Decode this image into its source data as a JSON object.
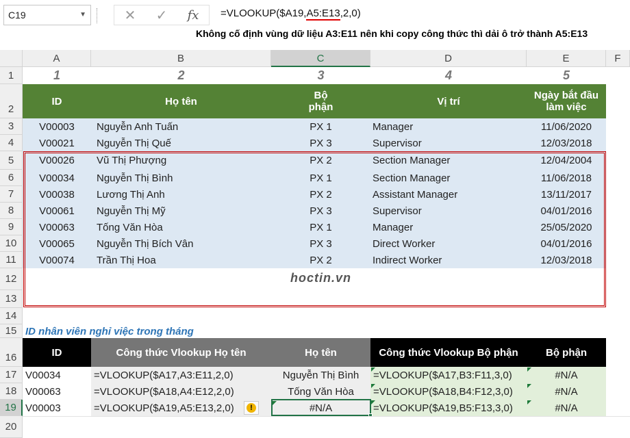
{
  "namebox": "C19",
  "formula": {
    "prefix": "=VLOOKUP($A19,",
    "range": "A5:E13",
    "suffix": ",2,0)"
  },
  "note": "Không cố định vùng dữ liệu A3:E11 nên khi copy công thức thì dải ô trở thành A5:E13",
  "columns": [
    "A",
    "B",
    "C",
    "D",
    "E",
    "F"
  ],
  "rows": [
    "1",
    "2",
    "3",
    "4",
    "5",
    "6",
    "7",
    "8",
    "9",
    "10",
    "11",
    "12",
    "13",
    "14",
    "15",
    "16",
    "17",
    "18",
    "19",
    "20"
  ],
  "row1": [
    "1",
    "2",
    "3",
    "4",
    "5"
  ],
  "header": {
    "id": "ID",
    "name": "Họ tên",
    "dept1": "Bộ",
    "dept2": "phận",
    "pos": "Vị trí",
    "date1": "Ngày bắt đầu",
    "date2": "làm việc"
  },
  "employees": [
    [
      "V00003",
      "Nguyễn Anh Tuấn",
      "PX 1",
      "Manager",
      "11/06/2020"
    ],
    [
      "V00021",
      "Nguyễn Thị Quế",
      "PX 3",
      "Supervisor",
      "12/03/2018"
    ],
    [
      "V00026",
      "Vũ Thị Phượng",
      "PX 2",
      "Section Manager",
      "12/04/2004"
    ],
    [
      "V00034",
      "Nguyễn Thị Bình",
      "PX 1",
      "Section Manager",
      "11/06/2018"
    ],
    [
      "V00038",
      "Lương Thị Anh",
      "PX 2",
      "Assistant Manager",
      "13/11/2017"
    ],
    [
      "V00061",
      "Nguyễn Thị Mỹ",
      "PX 3",
      "Supervisor",
      "04/01/2016"
    ],
    [
      "V00063",
      "Tống Văn Hòa",
      "PX 1",
      "Manager",
      "25/05/2020"
    ],
    [
      "V00065",
      "Nguyễn Thị Bích Vân",
      "PX 3",
      "Direct Worker",
      "04/01/2016"
    ],
    [
      "V00074",
      "Trần Thị Hoa",
      "PX 2",
      "Indirect Worker",
      "12/03/2018"
    ]
  ],
  "watermark": "hoctin.vn",
  "section_title": "ID nhân viên nghỉ việc trong tháng",
  "lookup_header": {
    "id": "ID",
    "f_name": "Công thức Vlookup Họ tên",
    "name": "Họ tên",
    "f_dept": "Công thức Vlookup Bộ phận",
    "dept": "Bộ phận"
  },
  "lookup_rows": [
    {
      "id": "V00034",
      "f_name": "=VLOOKUP($A17,A3:E11,2,0)",
      "name": "Nguyễn Thị Bình",
      "f_dept": "=VLOOKUP($A17,B3:F11,3,0)",
      "dept": "#N/A"
    },
    {
      "id": "V00063",
      "f_name": "=VLOOKUP($A18,A4:E12,2,0)",
      "name": "Tống Văn Hòa",
      "f_dept": "=VLOOKUP($A18,B4:F12,3,0)",
      "dept": "#N/A"
    },
    {
      "id": "V00003",
      "f_name": "=VLOOKUP($A19,A5:E13,2,0)",
      "name": "#N/A",
      "f_dept": "=VLOOKUP($A19,B5:F13,3,0)",
      "dept": "#N/A"
    }
  ],
  "colors": {
    "green_header": "#548235",
    "blue_fill": "#dde8f3",
    "red_border": "#c00000",
    "black_header": "#000000",
    "gray_header": "#767676",
    "excel_green": "#217346"
  }
}
